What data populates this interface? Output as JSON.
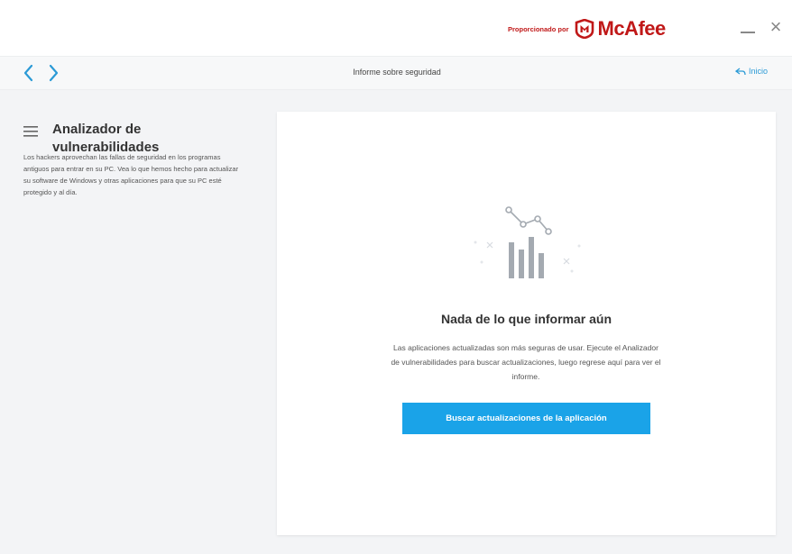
{
  "app": {
    "brand_prefix": "Proporcionado por",
    "brand_name": "McAfee",
    "brand_color": "#c01818"
  },
  "window_controls": {
    "minimize_icon": "minimize-icon",
    "close_icon": "close-icon",
    "close_glyph": "×"
  },
  "nav": {
    "back_icon": "chevron-left-icon",
    "forward_icon": "chevron-right-icon",
    "title": "Informe sobre seguridad",
    "home_label": "Inicio",
    "accent_color": "#2b9ad6"
  },
  "sidebar": {
    "menu_icon": "hamburger-menu-icon",
    "title": "Analizador de vulnerabilidades",
    "description": "Los hackers aprovechan las fallas de seguridad en los programas antiguos para entrar en su PC. Vea lo que hemos hecho para actualizar su software de Windows y otras aplicaciones para que su PC esté protegido y al día."
  },
  "card": {
    "illustration_icon": "bar-chart-trend-icon",
    "title": "Nada de lo que informar aún",
    "text": "Las aplicaciones actualizadas son más seguras de usar. Ejecute el Analizador de vulnerabilidades para buscar actualizaciones, luego regrese aquí para ver el informe.",
    "button_label": "Buscar actualizaciones de la aplicación",
    "button_color": "#1aa3e8"
  }
}
